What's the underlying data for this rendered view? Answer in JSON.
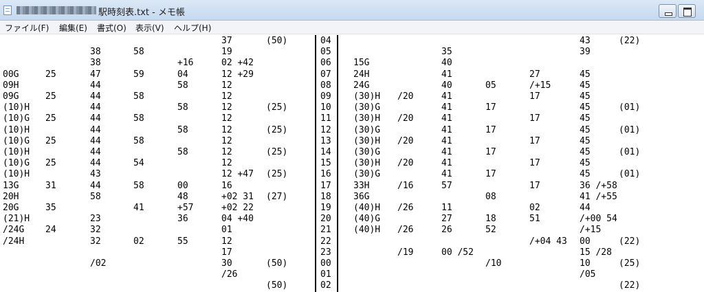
{
  "titlebar": {
    "title": "駅時刻表.txt - メモ帳"
  },
  "menu": [
    "ファイル(F)",
    "編集(E)",
    "書式(O)",
    "表示(V)",
    "ヘルプ(H)"
  ],
  "rows": [
    [
      "",
      "",
      "",
      "",
      "",
      "37",
      "(50)",
      "04",
      "",
      "",
      "",
      "",
      "",
      "",
      "43",
      "(22)"
    ],
    [
      "",
      "",
      "38",
      "58",
      "",
      "19",
      "",
      "05",
      "",
      "",
      "35",
      "",
      "",
      "",
      "39",
      ""
    ],
    [
      "",
      "",
      "38",
      "",
      "+16",
      "02 +42",
      "",
      "06",
      "15G",
      "",
      "40",
      "",
      "",
      "",
      "",
      ""
    ],
    [
      "00G",
      "25",
      "47",
      "59",
      "04",
      "12 +29",
      "",
      "07",
      "24H",
      "",
      "41",
      "",
      "27",
      "",
      "45",
      ""
    ],
    [
      "09H",
      "",
      "44",
      "",
      "58",
      "12",
      "",
      "08",
      "24G",
      "",
      "40",
      "05",
      "/+15",
      "",
      "45",
      ""
    ],
    [
      "09G",
      "25",
      "44",
      "58",
      "",
      "12",
      "",
      "09",
      "(30)H",
      "/20",
      "41",
      "",
      "17",
      "",
      "45",
      ""
    ],
    [
      "(10)H",
      "",
      "44",
      "",
      "58",
      "12",
      "(25)",
      "10",
      "(30)G",
      "",
      "41",
      "17",
      "",
      "",
      "45",
      "(01)"
    ],
    [
      "(10)G",
      "25",
      "44",
      "58",
      "",
      "12",
      "",
      "11",
      "(30)H",
      "/20",
      "41",
      "",
      "17",
      "",
      "45",
      ""
    ],
    [
      "(10)H",
      "",
      "44",
      "",
      "58",
      "12",
      "(25)",
      "12",
      "(30)G",
      "",
      "41",
      "17",
      "",
      "",
      "45",
      "(01)"
    ],
    [
      "(10)G",
      "25",
      "44",
      "58",
      "",
      "12",
      "",
      "13",
      "(30)H",
      "/20",
      "41",
      "",
      "17",
      "",
      "45",
      ""
    ],
    [
      "(10)H",
      "",
      "44",
      "",
      "58",
      "12",
      "(25)",
      "14",
      "(30)G",
      "",
      "41",
      "17",
      "",
      "",
      "45",
      "(01)"
    ],
    [
      "(10)G",
      "25",
      "44",
      "54",
      "",
      "12",
      "",
      "15",
      "(30)H",
      "/20",
      "41",
      "",
      "17",
      "",
      "45",
      ""
    ],
    [
      "(10)H",
      "",
      "43",
      "",
      "",
      "12 +47",
      "(25)",
      "16",
      "(30)G",
      "",
      "41",
      "17",
      "",
      "",
      "45",
      "(01)"
    ],
    [
      "13G",
      "31",
      "44",
      "58",
      "00",
      "16",
      "",
      "17",
      "33H",
      "/16",
      "57",
      "",
      "17",
      "",
      "36 /+58",
      ""
    ],
    [
      "20H",
      "",
      "58",
      "",
      "48",
      "+02 31",
      "(27)",
      "18",
      "36G",
      "",
      "",
      "08",
      "",
      "",
      "41 /+55",
      ""
    ],
    [
      "20G",
      "35",
      "",
      "41",
      "+57",
      "+02 22",
      "",
      "19",
      "(40)H",
      "/26",
      "11",
      "",
      "02",
      "",
      "44",
      ""
    ],
    [
      "(21)H",
      "",
      "23",
      "",
      "36",
      "04 +40",
      "",
      "20",
      "(40)G",
      "",
      "27",
      "18",
      "51",
      "",
      "/+00 54",
      ""
    ],
    [
      "/24G",
      "24",
      "32",
      "",
      "",
      "01",
      "",
      "21",
      "(40)H",
      "/26",
      "26",
      "52",
      "",
      "",
      "/+15",
      ""
    ],
    [
      "/24H",
      "",
      "32",
      "02",
      "55",
      "12",
      "",
      "22",
      "",
      "",
      "",
      "",
      "/+04 43",
      "",
      "00",
      "(22)"
    ],
    [
      "",
      "",
      "",
      "",
      "",
      "17",
      "",
      "23",
      "",
      "/19",
      "00 /52",
      "",
      "",
      "",
      "15 /28",
      ""
    ],
    [
      "",
      "",
      "/02",
      "",
      "",
      "30",
      "(50)",
      "00",
      "",
      "",
      "",
      "/10",
      "",
      "",
      "10",
      "(25)"
    ],
    [
      "",
      "",
      "",
      "",
      "",
      "/26",
      "",
      "01",
      "",
      "",
      "",
      "",
      "",
      "",
      "/05",
      ""
    ],
    [
      "",
      "",
      "",
      "",
      "",
      "",
      "(50)",
      "02",
      "",
      "",
      "",
      "",
      "",
      "",
      "",
      "(22)"
    ]
  ]
}
